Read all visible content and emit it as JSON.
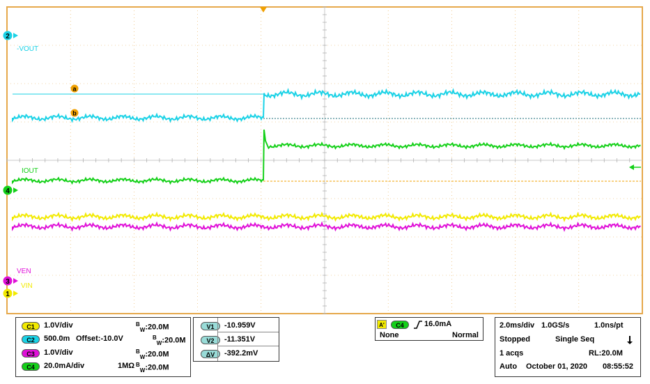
{
  "colors": {
    "ch1": "#f2ea00",
    "ch2": "#1ad2e6",
    "ch3": "#e010d8",
    "ch4": "#14d018",
    "grid": "#e6a84a",
    "ref": "#f0a000",
    "frame": "#e6a84a"
  },
  "waveform": {
    "labels": {
      "ch2": "-VOUT",
      "ch4": "IOUT",
      "ch3": "VEN",
      "ch1": "VIN"
    },
    "channel_markers": {
      "ch2": "2",
      "ch4": "4",
      "ch3": "3",
      "ch1": "1"
    },
    "cursors": {
      "a": "a",
      "b": "b"
    }
  },
  "channels_panel": {
    "rows": [
      {
        "id": "C1",
        "scale": "1.0V/div",
        "offset": "",
        "coupling": "",
        "bw_prefix": "B",
        "bw_sub": "W",
        "bw_value": ":20.0M"
      },
      {
        "id": "C2",
        "scale": "500.0m",
        "offset": "Offset:-10.0V",
        "coupling": "",
        "bw_prefix": "B",
        "bw_sub": "W",
        "bw_value": ":20.0M"
      },
      {
        "id": "C3",
        "scale": "1.0V/div",
        "offset": "",
        "coupling": "",
        "bw_prefix": "B",
        "bw_sub": "W",
        "bw_value": ":20.0M"
      },
      {
        "id": "C4",
        "scale": "20.0mA/div",
        "offset": "",
        "coupling": "1MΩ",
        "bw_prefix": "B",
        "bw_sub": "W",
        "bw_value": ":20.0M"
      }
    ]
  },
  "measurements": {
    "rows": [
      {
        "label": "V1",
        "value": "-10.959V"
      },
      {
        "label": "V2",
        "value": "-11.351V"
      },
      {
        "label": "ΔV",
        "value": "-392.2mV"
      }
    ]
  },
  "trigger": {
    "mode_icon": "A'",
    "source": "C4",
    "edge_icon": "rising-edge-icon",
    "level": "16.0mA",
    "coupling": "None",
    "type": "Normal"
  },
  "acquisition": {
    "timebase": "2.0ms/div",
    "sample_rate": "1.0GS/s",
    "resolution": "1.0ns/pt",
    "state": "Stopped",
    "seq": "Single Seq",
    "acqs": "1 acqs",
    "record_length": "RL:20.0M",
    "mode": "Auto",
    "date": "October 01, 2020",
    "time": "08:55:52"
  }
}
